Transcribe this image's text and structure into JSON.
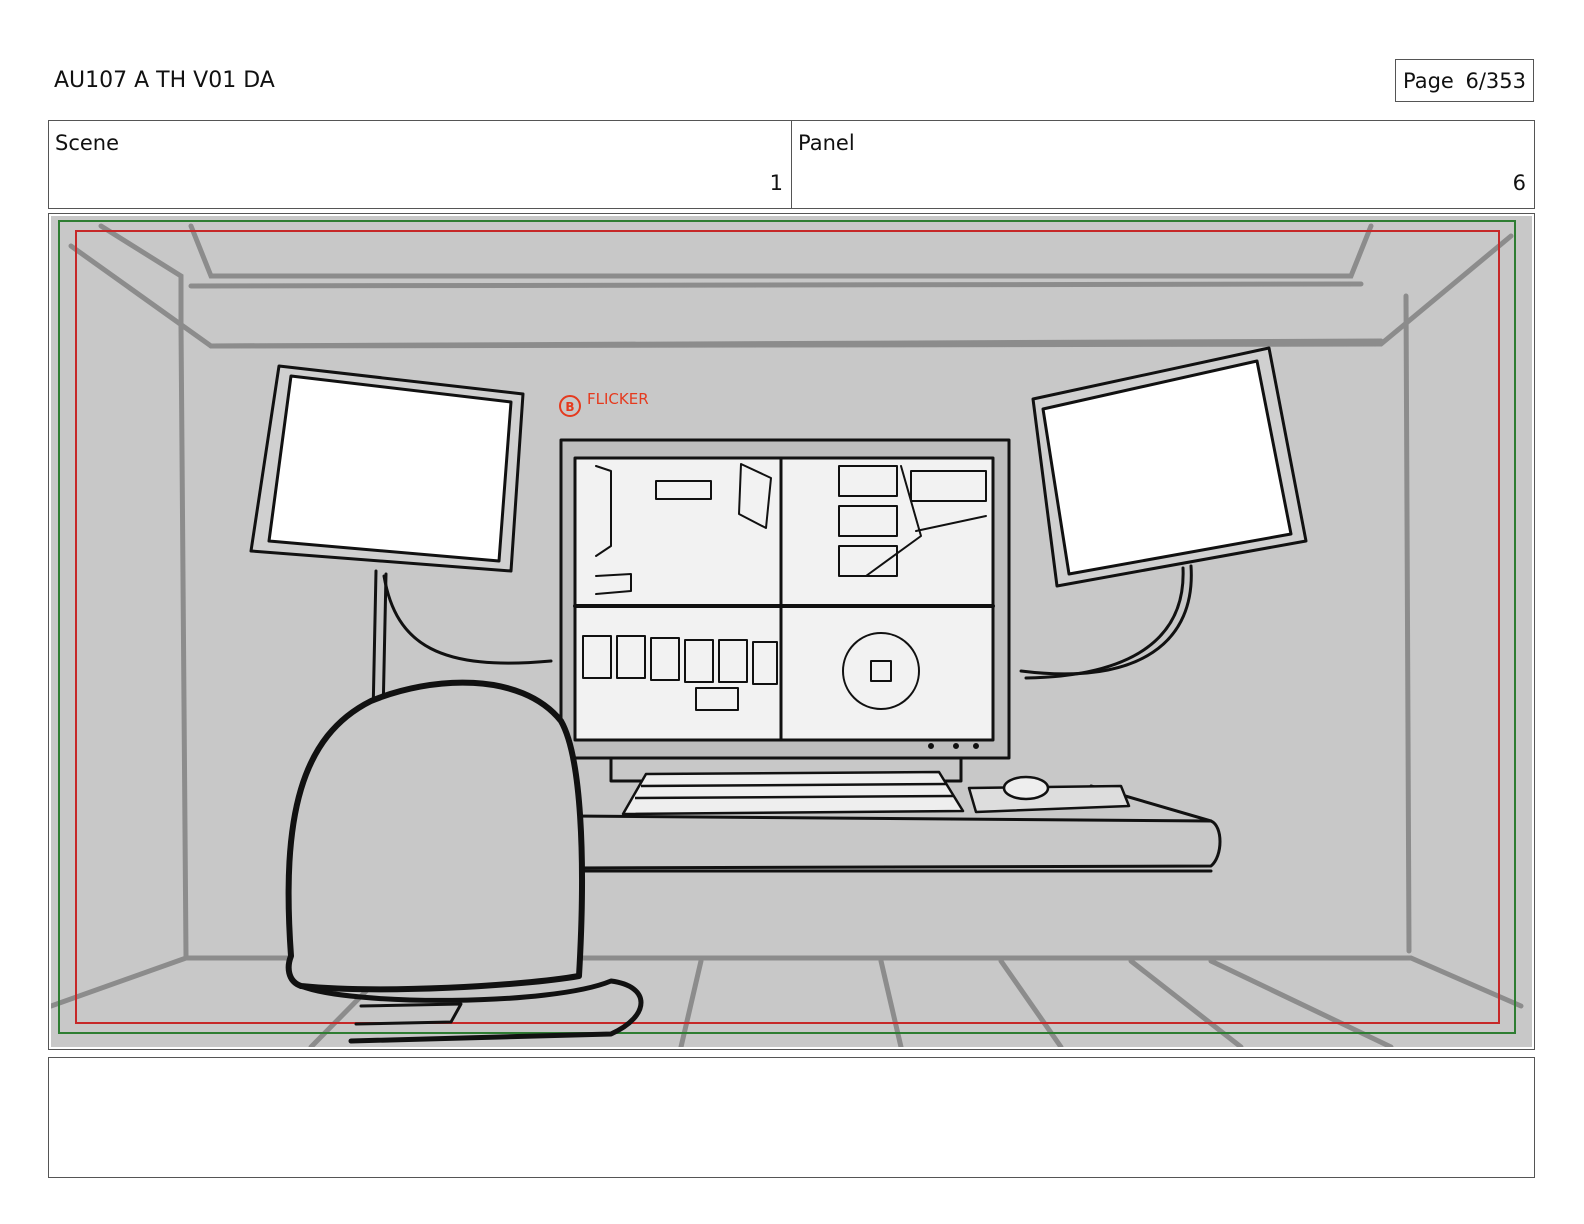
{
  "header": {
    "doc_title": "AU107 A TH V01 DA",
    "page_label": "Page",
    "page_number": "6/353"
  },
  "info": {
    "scene_label": "Scene",
    "scene_value": "1",
    "panel_label": "Panel",
    "panel_value": "6"
  },
  "panel": {
    "annotation_marker": "B",
    "annotation_text": "FLICKER"
  },
  "notes": {
    "text": ""
  },
  "colors": {
    "background": "#c8c8c8",
    "safe_area_outer": "#2e7d32",
    "safe_area_inner": "#c62828",
    "annotation": "#e53a1e",
    "ink": "#111111"
  }
}
